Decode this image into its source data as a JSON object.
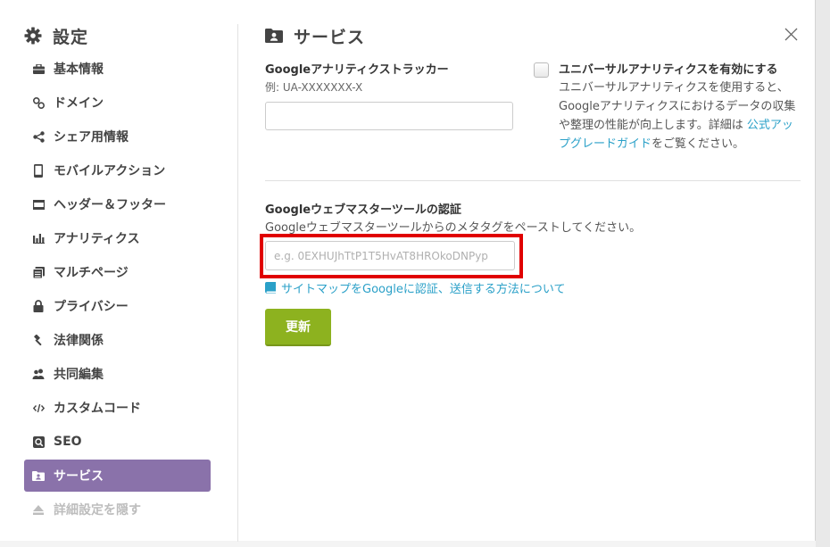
{
  "sidebar": {
    "title": "設定",
    "items": [
      {
        "label": "基本情報",
        "icon": "briefcase-icon"
      },
      {
        "label": "ドメイン",
        "icon": "link-icon"
      },
      {
        "label": "シェア用情報",
        "icon": "share-icon"
      },
      {
        "label": "モバイルアクション",
        "icon": "mobile-icon"
      },
      {
        "label": "ヘッダー＆フッター",
        "icon": "header-footer-icon"
      },
      {
        "label": "アナリティクス",
        "icon": "bar-chart-icon"
      },
      {
        "label": "マルチページ",
        "icon": "pages-icon"
      },
      {
        "label": "プライバシー",
        "icon": "lock-icon"
      },
      {
        "label": "法律関係",
        "icon": "gavel-icon"
      },
      {
        "label": "共同編集",
        "icon": "users-icon"
      },
      {
        "label": "カスタムコード",
        "icon": "code-icon"
      },
      {
        "label": "SEO",
        "icon": "search-icon"
      },
      {
        "label": "サービス",
        "icon": "folder-user-icon",
        "active": true
      },
      {
        "label": "詳細設定を隠す",
        "icon": "eject-icon",
        "muted": true
      }
    ]
  },
  "main": {
    "title": "サービス",
    "ga": {
      "label": "Googleアナリティクストラッカー",
      "example": "例: UA-XXXXXXX-X",
      "value": ""
    },
    "universal": {
      "title": "ユニバーサルアナリティクスを有効にする",
      "desc_before": "ユニバーサルアナリティクスを使用すると、Googleアナリティクスにおけるデータの収集や整理の性能が向上します。詳細は ",
      "link": "公式アップグレードガイド",
      "desc_after": "をご覧ください。",
      "checked": false
    },
    "gwt": {
      "label": "Googleウェブマスターツールの認証",
      "desc": "Googleウェブマスターツールからのメタタグをペーストしてください。",
      "placeholder": "e.g. 0EXHUJhTtP1T5HvAT8HROkoDNPyp",
      "link": "サイトマップをGoogleに認証、送信する方法について"
    },
    "update_label": "更新"
  },
  "colors": {
    "active_nav": "#8a72aa",
    "update_button": "#8db21f",
    "link": "#2aa0c8",
    "highlight": "#e00000"
  }
}
